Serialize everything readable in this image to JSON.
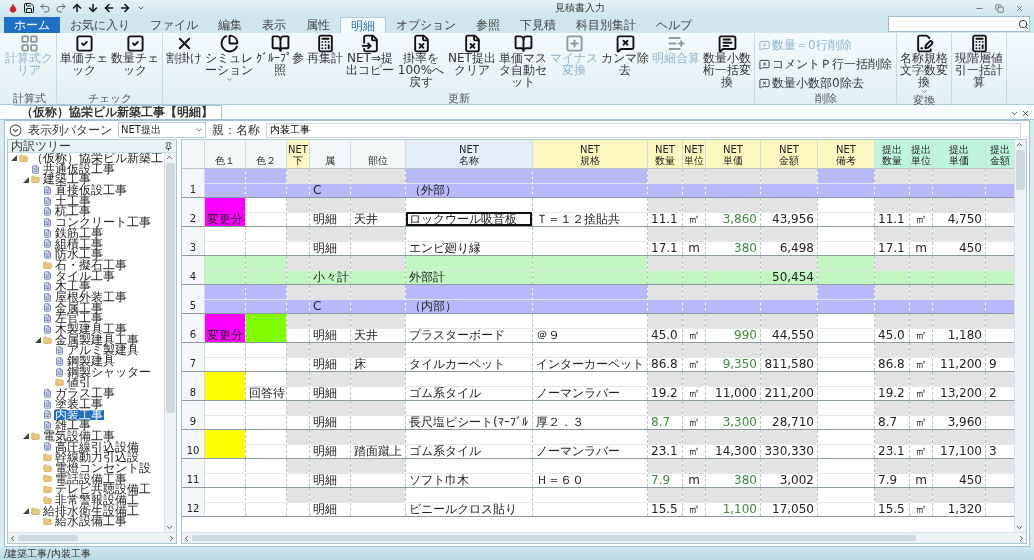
{
  "window": {
    "title": "見積書入力"
  },
  "menu_tabs": [
    {
      "label": "ホーム",
      "kind": "app",
      "selected": false
    },
    {
      "label": "お気に入り",
      "kind": "tab",
      "selected": false
    },
    {
      "label": "ファイル",
      "kind": "tab",
      "selected": false
    },
    {
      "label": "編集",
      "kind": "tab",
      "selected": false
    },
    {
      "label": "表示",
      "kind": "tab",
      "selected": false
    },
    {
      "label": "属性",
      "kind": "tab",
      "selected": false
    },
    {
      "label": "明細",
      "kind": "tab",
      "selected": true
    },
    {
      "label": "オプション",
      "kind": "tab",
      "selected": false
    },
    {
      "label": "参照",
      "kind": "tab",
      "selected": false
    },
    {
      "label": "下見積",
      "kind": "tab",
      "selected": false
    },
    {
      "label": "科目別集計",
      "kind": "tab",
      "selected": false
    },
    {
      "label": "ヘルプ",
      "kind": "tab",
      "selected": false
    }
  ],
  "ribbon": [
    {
      "label": "計算式",
      "kind": "large",
      "buttons": [
        {
          "label": "計算式クリア",
          "disabled": true,
          "dropdown": false
        }
      ]
    },
    {
      "label": "チェック",
      "kind": "large",
      "buttons": [
        {
          "label": "単価チェック",
          "disabled": false,
          "dropdown": false
        },
        {
          "label": "数量チェック",
          "disabled": false,
          "dropdown": false
        }
      ]
    },
    {
      "label": "更新",
      "kind": "large",
      "buttons": [
        {
          "label": "割掛け",
          "disabled": false,
          "dropdown": false
        },
        {
          "label": "シミュレーション",
          "disabled": false,
          "dropdown": true
        },
        {
          "label": "ｸﾞﾙｰﾌﾟ参照",
          "disabled": false,
          "dropdown": false
        },
        {
          "label": "再集計",
          "disabled": false,
          "dropdown": false
        },
        {
          "label": "NET⇒提出コピー",
          "disabled": false,
          "dropdown": false
        },
        {
          "label": "掛率を100%へ戻す",
          "disabled": false,
          "dropdown": false
        },
        {
          "label": "NET提出クリア",
          "disabled": false,
          "dropdown": false
        },
        {
          "label": "単価マスタ自動セット",
          "disabled": false,
          "dropdown": false
        },
        {
          "label": "マイナス変換",
          "disabled": true,
          "dropdown": false
        },
        {
          "label": "カンマ除去",
          "disabled": false,
          "dropdown": false
        },
        {
          "label": "明細合算",
          "disabled": true,
          "dropdown": false
        },
        {
          "label": "数量小数桁一括変換",
          "disabled": false,
          "dropdown": false
        }
      ]
    },
    {
      "label": "削除",
      "kind": "small",
      "buttons": [
        {
          "label": "数量＝0行削除",
          "disabled": true,
          "dropdown": false
        },
        {
          "label": "コメントＰ行一括削除",
          "disabled": false,
          "dropdown": false
        },
        {
          "label": "数量小数部0除去",
          "disabled": false,
          "dropdown": false
        }
      ]
    },
    {
      "label": "変換",
      "kind": "large",
      "buttons": [
        {
          "label": "名称規格文字数変換",
          "disabled": false,
          "dropdown": true
        }
      ]
    },
    {
      "kind": "large",
      "buttons": [
        {
          "label": "現階層値引一括計算",
          "disabled": false,
          "dropdown": false
        }
      ]
    }
  ],
  "document_tab": {
    "label": "（仮称）協栄ビル新築工事【明細】"
  },
  "filter_bar": {
    "pattern_label": "表示列パターン",
    "pattern_value": "NET提出",
    "parent_label": "親：名称",
    "parent_value": "内装工事"
  },
  "tree": {
    "title": "内訳ツリー",
    "items": [
      {
        "label": "（仮称）協栄ビル新築工",
        "kind": "folder",
        "expanded": true,
        "selected": false,
        "children": [
          {
            "label": "共通仮設工事",
            "kind": "page",
            "selected": false
          },
          {
            "label": "建築工事",
            "kind": "folder",
            "expanded": true,
            "selected": false,
            "children": [
              {
                "label": "直接仮設工事",
                "kind": "page",
                "selected": false
              },
              {
                "label": "土工事",
                "kind": "page",
                "selected": false
              },
              {
                "label": "杭工事",
                "kind": "page",
                "selected": false
              },
              {
                "label": "コンクリート工事",
                "kind": "page",
                "selected": false
              },
              {
                "label": "鉄筋工事",
                "kind": "page",
                "selected": false
              },
              {
                "label": "組積工事",
                "kind": "page",
                "selected": false
              },
              {
                "label": "防水工事",
                "kind": "page",
                "selected": false
              },
              {
                "label": "石・擬石工事",
                "kind": "folder",
                "selected": false
              },
              {
                "label": "タイル工事",
                "kind": "page",
                "selected": false
              },
              {
                "label": "木工事",
                "kind": "page",
                "selected": false
              },
              {
                "label": "屋根外装工事",
                "kind": "page",
                "selected": false
              },
              {
                "label": "金属工事",
                "kind": "page",
                "selected": false
              },
              {
                "label": "左官工事",
                "kind": "page",
                "selected": false
              },
              {
                "label": "木製建具工事",
                "kind": "page",
                "selected": false
              },
              {
                "label": "金属製建具工事",
                "kind": "folder",
                "expanded": true,
                "selected": false,
                "children": [
                  {
                    "label": "アルミ製建具",
                    "kind": "page",
                    "selected": false
                  },
                  {
                    "label": "鋼製建具",
                    "kind": "page",
                    "selected": false
                  },
                  {
                    "label": "鋼製シャッター",
                    "kind": "page",
                    "selected": false
                  },
                  {
                    "label": "値引",
                    "kind": "folder",
                    "selected": false
                  }
                ]
              },
              {
                "label": "ガラス工事",
                "kind": "page",
                "selected": false
              },
              {
                "label": "塗装工事",
                "kind": "page",
                "selected": false
              },
              {
                "label": "内装工事",
                "kind": "page",
                "selected": true
              },
              {
                "label": "雑工事",
                "kind": "page",
                "selected": false
              }
            ]
          },
          {
            "label": "電気設備工事",
            "kind": "folder",
            "expanded": true,
            "selected": false,
            "children": [
              {
                "label": "高圧線引込設備",
                "kind": "page",
                "selected": false
              },
              {
                "label": "幹線動力引込設",
                "kind": "folder",
                "selected": false
              },
              {
                "label": "電燈コンセント設",
                "kind": "folder",
                "selected": false
              },
              {
                "label": "電話設備工事",
                "kind": "folder",
                "selected": false
              },
              {
                "label": "テレビ共聴設備工",
                "kind": "folder",
                "selected": false
              },
              {
                "label": "非常警報設備工",
                "kind": "folder",
                "selected": false
              }
            ]
          },
          {
            "label": "給排水衛生設備工",
            "kind": "folder",
            "expanded": true,
            "selected": false,
            "children": [
              {
                "label": "給水設備工事",
                "kind": "folder",
                "selected": false
              }
            ]
          }
        ]
      }
    ]
  },
  "grid": {
    "columns": [
      {
        "lines": [
          "色１"
        ],
        "kind": "base"
      },
      {
        "lines": [
          "色２"
        ],
        "kind": "base"
      },
      {
        "lines": [
          "NET",
          "下"
        ],
        "kind": "net"
      },
      {
        "lines": [
          "属"
        ],
        "kind": "base"
      },
      {
        "lines": [
          "部位"
        ],
        "kind": "base"
      },
      {
        "lines": [
          "NET",
          "名称"
        ],
        "kind": "current"
      },
      {
        "lines": [
          "NET",
          "規格"
        ],
        "kind": "net"
      },
      {
        "lines": [
          "NET",
          "数量"
        ],
        "kind": "net"
      },
      {
        "lines": [
          "NET",
          "単位"
        ],
        "kind": "net"
      },
      {
        "lines": [
          "NET",
          "単価"
        ],
        "kind": "net"
      },
      {
        "lines": [
          "NET",
          "金額"
        ],
        "kind": "net"
      },
      {
        "lines": [
          "NET",
          "備考"
        ],
        "kind": "net"
      },
      {
        "lines": [
          "提出",
          "数量"
        ],
        "kind": "submit"
      },
      {
        "lines": [
          "提出",
          "単位"
        ],
        "kind": "submit"
      },
      {
        "lines": [
          "提出",
          "単価"
        ],
        "kind": "submit"
      },
      {
        "lines": [
          "提出",
          "金額"
        ],
        "kind": "submit"
      }
    ],
    "rows": [
      {
        "no": "1",
        "kind": "section",
        "selected": false,
        "type": "C",
        "name": "（外部）"
      },
      {
        "no": "2",
        "kind": "detail",
        "selected": true,
        "color_1": {
          "color": "#ff00ff",
          "label": "変更分"
        },
        "type": "明細",
        "part": "天井",
        "name": "ロックウール吸音板",
        "spec": "Ｔ＝１２捨貼共",
        "qty": "11.1",
        "unit": "㎡",
        "price": "3,860",
        "amount": "43,956",
        "s_qty": "11.1",
        "s_unit": "㎡",
        "s_price": "4,750",
        "qty_marked": false,
        "price_marked": true
      },
      {
        "no": "3",
        "kind": "detail",
        "selected": false,
        "type": "明細",
        "name": "エンビ廻り縁",
        "qty": "17.1",
        "unit": "m",
        "price": "380",
        "amount": "6,498",
        "s_qty": "17.1",
        "s_unit": "m",
        "s_price": "450",
        "qty_marked": false,
        "price_marked": true
      },
      {
        "no": "4",
        "kind": "subtotal",
        "selected": false,
        "type": "小々計",
        "name": "外部計",
        "amount": "50,454"
      },
      {
        "no": "5",
        "kind": "section",
        "selected": false,
        "type": "C",
        "name": "（内部）"
      },
      {
        "no": "6",
        "kind": "detail",
        "selected": false,
        "color_1": {
          "color": "#ff00ff",
          "label": "変更分"
        },
        "color_2": {
          "color": "#80ff00"
        },
        "type": "明細",
        "part": "天井",
        "name": "プラスターボード",
        "spec": "＠９",
        "qty": "45.0",
        "unit": "㎡",
        "price": "990",
        "amount": "44,550",
        "s_qty": "45.0",
        "s_unit": "㎡",
        "s_price": "1,180",
        "qty_marked": false,
        "price_marked": true
      },
      {
        "no": "7",
        "kind": "detail",
        "selected": false,
        "type": "明細",
        "part": "床",
        "name": "タイルカーペット",
        "spec": "インターカーペット",
        "qty": "86.8",
        "unit": "㎡",
        "price": "9,350",
        "amount": "811,580",
        "s_qty": "86.8",
        "s_unit": "㎡",
        "s_price": "11,200",
        "s_amount": "9",
        "qty_marked": false,
        "price_marked": true
      },
      {
        "no": "8",
        "kind": "detail",
        "selected": false,
        "color_1": {
          "color": "#ffff00"
        },
        "color_2": {
          "label": "回答待"
        },
        "type": "明細",
        "name": "ゴム系タイル",
        "spec": "ノーマンラバー",
        "qty": "19.2",
        "unit": "㎡",
        "price": "11,000",
        "amount": "211,200",
        "s_qty": "19.2",
        "s_unit": "㎡",
        "s_price": "13,200",
        "s_amount": "2",
        "qty_marked": false,
        "price_marked": false
      },
      {
        "no": "9",
        "kind": "detail",
        "selected": false,
        "type": "明細",
        "name": "長尺塩ビシート(ﾏｰﾌﾞﾙ",
        "spec": "厚２．３",
        "qty": "8.7",
        "unit": "㎡",
        "price": "3,300",
        "amount": "28,710",
        "s_qty": "8.7",
        "s_unit": "㎡",
        "s_price": "3,960",
        "qty_marked": true,
        "price_marked": true
      },
      {
        "no": "10",
        "kind": "detail",
        "selected": false,
        "color_1": {
          "color": "#ffff00"
        },
        "type": "明細",
        "part": "踏面蹴上",
        "name": "ゴム系タイル",
        "spec": "ノーマンラバー",
        "qty": "23.1",
        "unit": "㎡",
        "price": "14,300",
        "amount": "330,330",
        "s_qty": "23.1",
        "s_unit": "㎡",
        "s_price": "17,100",
        "s_amount": "3",
        "qty_marked": false,
        "price_marked": false
      },
      {
        "no": "11",
        "kind": "detail",
        "selected": false,
        "type": "明細",
        "name": "ソフト巾木",
        "spec": "Ｈ＝６０",
        "qty": "7.9",
        "unit": "m",
        "price": "380",
        "amount": "3,002",
        "s_qty": "7.9",
        "s_unit": "m",
        "s_price": "450",
        "qty_marked": true,
        "price_marked": true
      },
      {
        "no": "12",
        "kind": "detail",
        "selected": false,
        "type": "明細",
        "name": "ビニールクロス貼り",
        "qty": "15.5",
        "unit": "㎡",
        "price": "1,100",
        "amount": "17,050",
        "s_qty": "15.5",
        "s_unit": "㎡",
        "s_price": "1,320",
        "qty_marked": false,
        "price_marked": true
      }
    ]
  },
  "status_bar": {
    "path": "/建築工事/内装工事"
  }
}
